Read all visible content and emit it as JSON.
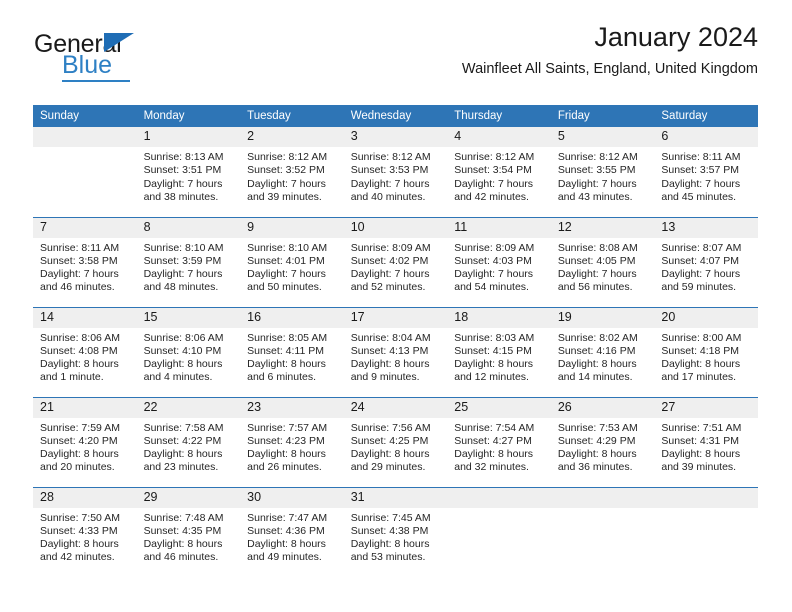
{
  "brand": {
    "name_part1": "General",
    "name_part2": "Blue",
    "triangle_icon": "triangle-icon",
    "accent_color": "#2E80C4"
  },
  "header": {
    "title": "January 2024",
    "subtitle": "Wainfleet All Saints, England, United Kingdom",
    "header_bg_color": "#2E75B6",
    "daynum_bg_color": "#efefef"
  },
  "weekdays": [
    "Sunday",
    "Monday",
    "Tuesday",
    "Wednesday",
    "Thursday",
    "Friday",
    "Saturday"
  ],
  "weeks": [
    [
      {
        "day": "",
        "lines": []
      },
      {
        "day": "1",
        "lines": [
          "Sunrise: 8:13 AM",
          "Sunset: 3:51 PM",
          "Daylight: 7 hours",
          "and 38 minutes."
        ]
      },
      {
        "day": "2",
        "lines": [
          "Sunrise: 8:12 AM",
          "Sunset: 3:52 PM",
          "Daylight: 7 hours",
          "and 39 minutes."
        ]
      },
      {
        "day": "3",
        "lines": [
          "Sunrise: 8:12 AM",
          "Sunset: 3:53 PM",
          "Daylight: 7 hours",
          "and 40 minutes."
        ]
      },
      {
        "day": "4",
        "lines": [
          "Sunrise: 8:12 AM",
          "Sunset: 3:54 PM",
          "Daylight: 7 hours",
          "and 42 minutes."
        ]
      },
      {
        "day": "5",
        "lines": [
          "Sunrise: 8:12 AM",
          "Sunset: 3:55 PM",
          "Daylight: 7 hours",
          "and 43 minutes."
        ]
      },
      {
        "day": "6",
        "lines": [
          "Sunrise: 8:11 AM",
          "Sunset: 3:57 PM",
          "Daylight: 7 hours",
          "and 45 minutes."
        ]
      }
    ],
    [
      {
        "day": "7",
        "lines": [
          "Sunrise: 8:11 AM",
          "Sunset: 3:58 PM",
          "Daylight: 7 hours",
          "and 46 minutes."
        ]
      },
      {
        "day": "8",
        "lines": [
          "Sunrise: 8:10 AM",
          "Sunset: 3:59 PM",
          "Daylight: 7 hours",
          "and 48 minutes."
        ]
      },
      {
        "day": "9",
        "lines": [
          "Sunrise: 8:10 AM",
          "Sunset: 4:01 PM",
          "Daylight: 7 hours",
          "and 50 minutes."
        ]
      },
      {
        "day": "10",
        "lines": [
          "Sunrise: 8:09 AM",
          "Sunset: 4:02 PM",
          "Daylight: 7 hours",
          "and 52 minutes."
        ]
      },
      {
        "day": "11",
        "lines": [
          "Sunrise: 8:09 AM",
          "Sunset: 4:03 PM",
          "Daylight: 7 hours",
          "and 54 minutes."
        ]
      },
      {
        "day": "12",
        "lines": [
          "Sunrise: 8:08 AM",
          "Sunset: 4:05 PM",
          "Daylight: 7 hours",
          "and 56 minutes."
        ]
      },
      {
        "day": "13",
        "lines": [
          "Sunrise: 8:07 AM",
          "Sunset: 4:07 PM",
          "Daylight: 7 hours",
          "and 59 minutes."
        ]
      }
    ],
    [
      {
        "day": "14",
        "lines": [
          "Sunrise: 8:06 AM",
          "Sunset: 4:08 PM",
          "Daylight: 8 hours",
          "and 1 minute."
        ]
      },
      {
        "day": "15",
        "lines": [
          "Sunrise: 8:06 AM",
          "Sunset: 4:10 PM",
          "Daylight: 8 hours",
          "and 4 minutes."
        ]
      },
      {
        "day": "16",
        "lines": [
          "Sunrise: 8:05 AM",
          "Sunset: 4:11 PM",
          "Daylight: 8 hours",
          "and 6 minutes."
        ]
      },
      {
        "day": "17",
        "lines": [
          "Sunrise: 8:04 AM",
          "Sunset: 4:13 PM",
          "Daylight: 8 hours",
          "and 9 minutes."
        ]
      },
      {
        "day": "18",
        "lines": [
          "Sunrise: 8:03 AM",
          "Sunset: 4:15 PM",
          "Daylight: 8 hours",
          "and 12 minutes."
        ]
      },
      {
        "day": "19",
        "lines": [
          "Sunrise: 8:02 AM",
          "Sunset: 4:16 PM",
          "Daylight: 8 hours",
          "and 14 minutes."
        ]
      },
      {
        "day": "20",
        "lines": [
          "Sunrise: 8:00 AM",
          "Sunset: 4:18 PM",
          "Daylight: 8 hours",
          "and 17 minutes."
        ]
      }
    ],
    [
      {
        "day": "21",
        "lines": [
          "Sunrise: 7:59 AM",
          "Sunset: 4:20 PM",
          "Daylight: 8 hours",
          "and 20 minutes."
        ]
      },
      {
        "day": "22",
        "lines": [
          "Sunrise: 7:58 AM",
          "Sunset: 4:22 PM",
          "Daylight: 8 hours",
          "and 23 minutes."
        ]
      },
      {
        "day": "23",
        "lines": [
          "Sunrise: 7:57 AM",
          "Sunset: 4:23 PM",
          "Daylight: 8 hours",
          "and 26 minutes."
        ]
      },
      {
        "day": "24",
        "lines": [
          "Sunrise: 7:56 AM",
          "Sunset: 4:25 PM",
          "Daylight: 8 hours",
          "and 29 minutes."
        ]
      },
      {
        "day": "25",
        "lines": [
          "Sunrise: 7:54 AM",
          "Sunset: 4:27 PM",
          "Daylight: 8 hours",
          "and 32 minutes."
        ]
      },
      {
        "day": "26",
        "lines": [
          "Sunrise: 7:53 AM",
          "Sunset: 4:29 PM",
          "Daylight: 8 hours",
          "and 36 minutes."
        ]
      },
      {
        "day": "27",
        "lines": [
          "Sunrise: 7:51 AM",
          "Sunset: 4:31 PM",
          "Daylight: 8 hours",
          "and 39 minutes."
        ]
      }
    ],
    [
      {
        "day": "28",
        "lines": [
          "Sunrise: 7:50 AM",
          "Sunset: 4:33 PM",
          "Daylight: 8 hours",
          "and 42 minutes."
        ]
      },
      {
        "day": "29",
        "lines": [
          "Sunrise: 7:48 AM",
          "Sunset: 4:35 PM",
          "Daylight: 8 hours",
          "and 46 minutes."
        ]
      },
      {
        "day": "30",
        "lines": [
          "Sunrise: 7:47 AM",
          "Sunset: 4:36 PM",
          "Daylight: 8 hours",
          "and 49 minutes."
        ]
      },
      {
        "day": "31",
        "lines": [
          "Sunrise: 7:45 AM",
          "Sunset: 4:38 PM",
          "Daylight: 8 hours",
          "and 53 minutes."
        ]
      },
      {
        "day": "",
        "lines": []
      },
      {
        "day": "",
        "lines": []
      },
      {
        "day": "",
        "lines": []
      }
    ]
  ]
}
